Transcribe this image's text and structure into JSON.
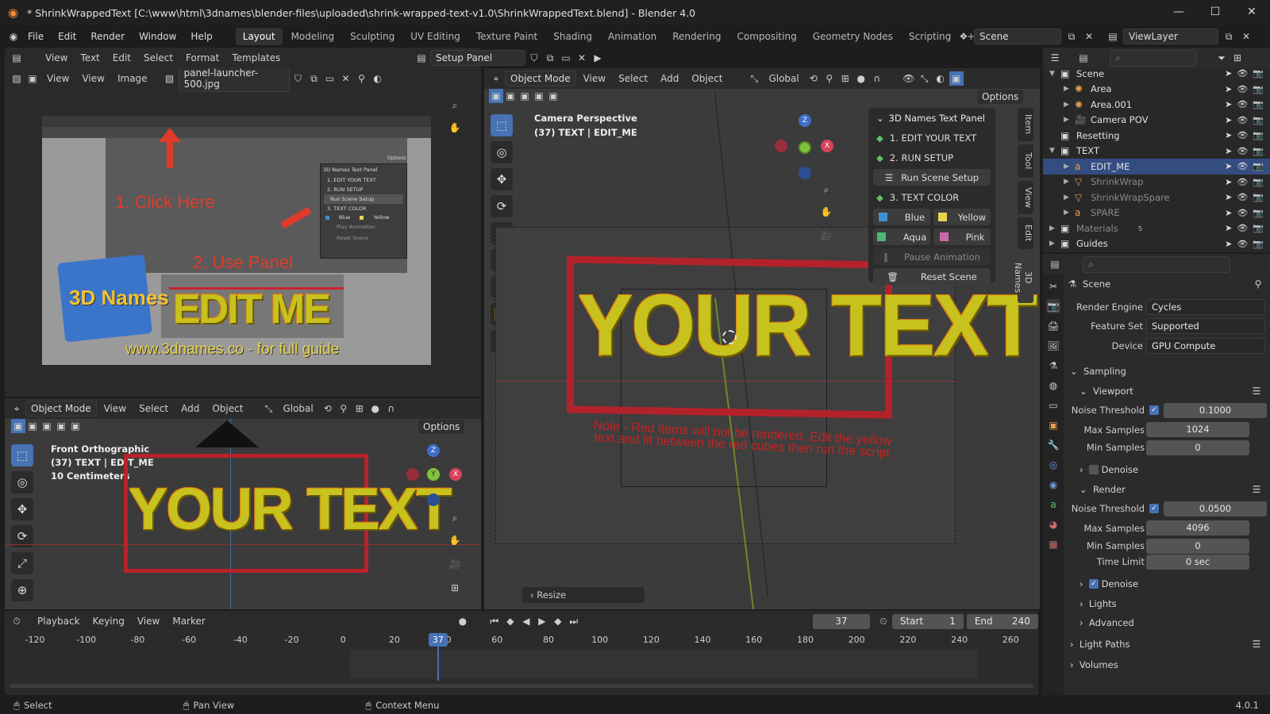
{
  "title": "* ShrinkWrappedText [C:\\www\\html\\3dnames\\blender-files\\uploaded\\shrink-wrapped-text-v1.0\\ShrinkWrappedText.blend] - Blender 4.0",
  "menu": [
    "File",
    "Edit",
    "Render",
    "Window",
    "Help"
  ],
  "workspaces": [
    "Layout",
    "Modeling",
    "Sculpting",
    "UV Editing",
    "Texture Paint",
    "Shading",
    "Animation",
    "Rendering",
    "Compositing",
    "Geometry Nodes",
    "Scripting"
  ],
  "scene_label": "Scene",
  "viewlayer_label": "ViewLayer",
  "text_editor": {
    "menus": [
      "View",
      "Text",
      "Edit",
      "Select",
      "Format",
      "Templates"
    ],
    "file": "Setup Panel"
  },
  "image_editor": {
    "menus": [
      "View",
      "View",
      "Image"
    ],
    "file": "panel-launcher-500.jpg"
  },
  "image": {
    "step1": "1. Click Here",
    "step2": "2. Use Panel",
    "logo": "3D Names",
    "edit": "EDIT ME",
    "url": "www.3dnames.co - for full guide",
    "mini_title": "3D Names Text Panel",
    "mini_items": [
      "1. EDIT YOUR TEXT",
      "2. RUN SETUP",
      "Run Scene Setup",
      "3. TEXT COLOR",
      "Blue",
      "Yellow",
      "Play Animation",
      "Reset Scene"
    ],
    "mini_options": "Options"
  },
  "front_vp": {
    "mode": "Object Mode",
    "menus": [
      "View",
      "Select",
      "Add",
      "Object"
    ],
    "orient": "Global",
    "options": "Options",
    "l1": "Front Orthographic",
    "l2": "(37) TEXT | EDIT_ME",
    "l3": "10 Centimeters",
    "text": "YOUR TEXT"
  },
  "main_vp": {
    "mode": "Object Mode",
    "menus": [
      "View",
      "Select",
      "Add",
      "Object"
    ],
    "orient": "Global",
    "options": "Options",
    "l1": "Camera Perspective",
    "l2": "(37) TEXT | EDIT_ME",
    "text": "YOUR TEXT",
    "note": "Note - Red items will not be rendered. Edit the yellow text and fit between the red cubes then run the script",
    "resize": "Resize",
    "tabs": [
      "Item",
      "Tool",
      "View",
      "Edit",
      "3D Names"
    ],
    "gizmo": {
      "z": "Z",
      "x": "X",
      "y": "Y"
    }
  },
  "npanel": {
    "title": "3D Names Text Panel",
    "step1": "1. EDIT YOUR TEXT",
    "step2": "2. RUN SETUP",
    "run": "Run Scene Setup",
    "step3": "3. TEXT COLOR",
    "colors": [
      {
        "name": "Blue",
        "hex": "#3e8fd6"
      },
      {
        "name": "Yellow",
        "hex": "#e8d44a"
      },
      {
        "name": "Aqua",
        "hex": "#49b87a"
      },
      {
        "name": "Pink",
        "hex": "#c96aa8"
      }
    ],
    "pause": "Pause Animation",
    "reset": "Reset Scene"
  },
  "outliner": {
    "rows": [
      {
        "name": "Scene",
        "indent": 0,
        "icon": "collection-icon"
      },
      {
        "name": "Area",
        "indent": 1,
        "icon": "light-icon"
      },
      {
        "name": "Area.001",
        "indent": 1,
        "icon": "light-icon"
      },
      {
        "name": "Camera POV",
        "indent": 1,
        "icon": "camera-icon"
      },
      {
        "name": "Resetting",
        "indent": 0,
        "icon": "collection-icon"
      },
      {
        "name": "TEXT",
        "indent": 0,
        "icon": "collection-icon"
      },
      {
        "name": "EDIT_ME",
        "indent": 1,
        "icon": "text-icon"
      },
      {
        "name": "ShrinkWrap",
        "indent": 1,
        "icon": "mesh-icon"
      },
      {
        "name": "ShrinkWrapSpare",
        "indent": 1,
        "icon": "mesh-icon"
      },
      {
        "name": "SPARE",
        "indent": 1,
        "icon": "text-icon"
      },
      {
        "name": "Materials",
        "indent": 0,
        "icon": "collection-icon",
        "extra": "5"
      },
      {
        "name": "Guides",
        "indent": 0,
        "icon": "collection-icon"
      }
    ]
  },
  "props": {
    "scene": "Scene",
    "render_engine_label": "Render Engine",
    "render_engine": "Cycles",
    "feature_set_label": "Feature Set",
    "feature_set": "Supported",
    "device_label": "Device",
    "device": "GPU Compute",
    "sampling": "Sampling",
    "viewport": "Viewport",
    "noise_label": "Noise Threshold",
    "vp_noise": "0.1000",
    "max_label": "Max Samples",
    "vp_max": "1024",
    "min_label": "Min Samples",
    "vp_min": "0",
    "denoise": "Denoise",
    "render": "Render",
    "r_noise": "0.0500",
    "r_max": "4096",
    "r_min": "0",
    "time_label": "Time Limit",
    "r_time": "0 sec",
    "lights": "Lights",
    "advanced": "Advanced",
    "light_paths": "Light Paths",
    "volumes": "Volumes"
  },
  "timeline": {
    "menus": [
      "Playback",
      "Keying",
      "View",
      "Marker"
    ],
    "frame": "37",
    "start_label": "Start",
    "start": "1",
    "end_label": "End",
    "end": "240",
    "ticks": [
      "-120",
      "-100",
      "-80",
      "-60",
      "-40",
      "-20",
      "0",
      "20",
      "40",
      "60",
      "80",
      "100",
      "120",
      "140",
      "160",
      "180",
      "200",
      "220",
      "240",
      "260"
    ]
  },
  "status": {
    "select": "Select",
    "pan": "Pan View",
    "context": "Context Menu",
    "version": "4.0.1"
  }
}
